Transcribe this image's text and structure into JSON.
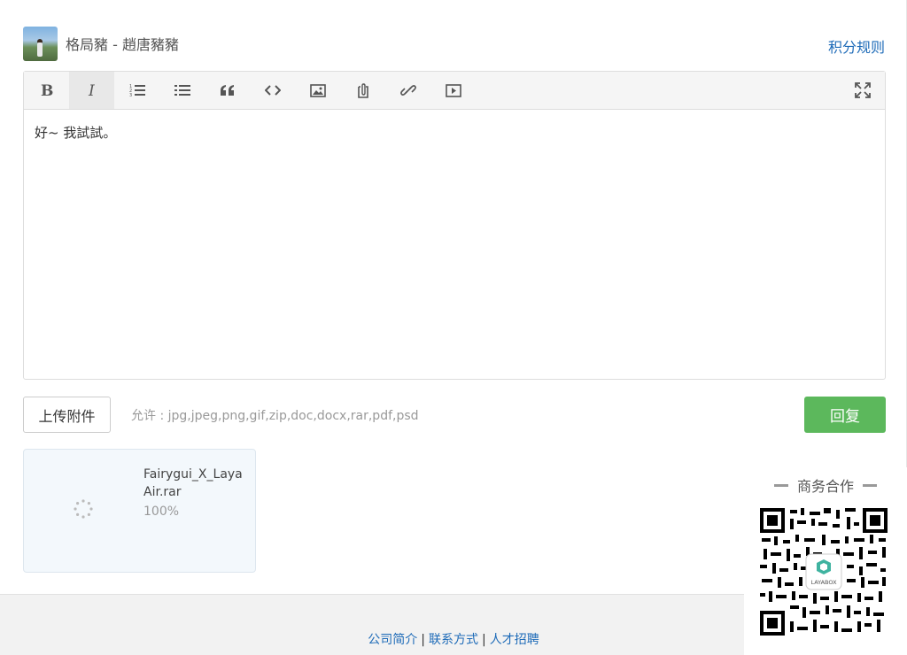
{
  "user": {
    "name": "格局豬 - 趙唐豬豬",
    "rules_link": "积分规则"
  },
  "toolbar": {
    "buttons": [
      "bold-icon",
      "italic-icon",
      "ordered-list-icon",
      "unordered-list-icon",
      "quote-icon",
      "code-icon",
      "image-icon",
      "attachment-icon",
      "link-icon",
      "video-icon"
    ],
    "fullscreen": "fullscreen-icon"
  },
  "editor": {
    "content": "好~ 我試試。"
  },
  "upload": {
    "button_label": "上传附件",
    "allowed": "允许 : jpg,jpeg,png,gif,zip,doc,docx,rar,pdf,psd"
  },
  "reply": {
    "label": "回复",
    "color": "#5cb85c"
  },
  "attachment": {
    "file_name": "Fairygui_X_LayaAir.rar",
    "progress": "100%"
  },
  "business": {
    "title": "商务合作",
    "qr_logo": "LAYABOX"
  },
  "footer": {
    "links": [
      "公司简介",
      "联系方式",
      "人才招聘"
    ]
  },
  "colors": {
    "link": "#1e6bb8",
    "accent_green": "#5cb85c"
  }
}
